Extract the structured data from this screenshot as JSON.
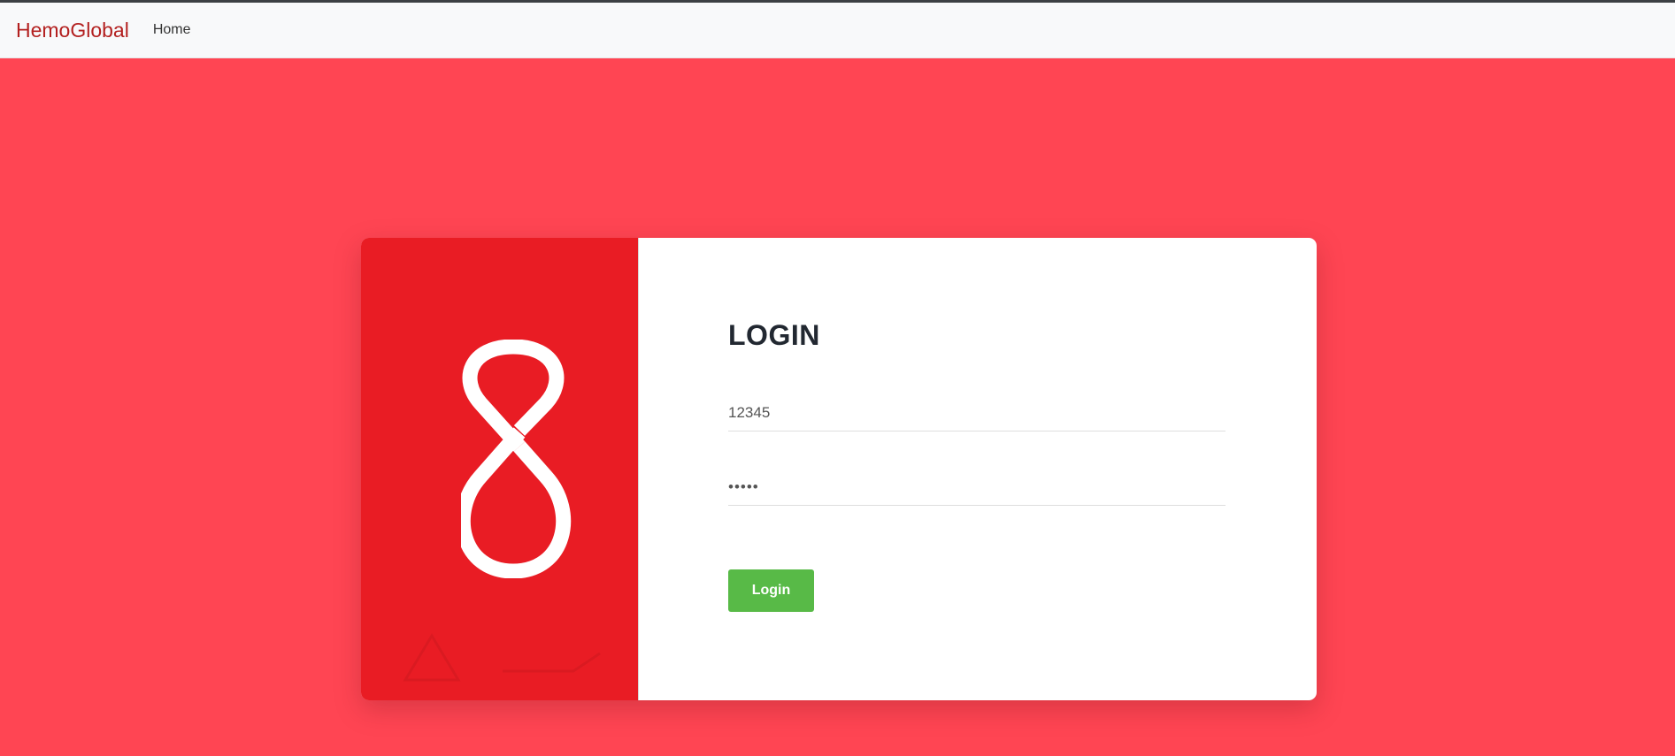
{
  "navbar": {
    "brand": "HemoGlobal",
    "links": [
      {
        "label": "Home"
      }
    ]
  },
  "login": {
    "title": "LOGIN",
    "username_value": "12345",
    "password_value": "•••••",
    "button_label": "Login"
  },
  "colors": {
    "page_background": "#ff4553",
    "brand": "#b3201f",
    "left_panel": "#e91c24",
    "button": "#58ba47",
    "navbar": "#f8f9fa"
  },
  "icons": {
    "logo": "infinity-ribbon-icon"
  }
}
